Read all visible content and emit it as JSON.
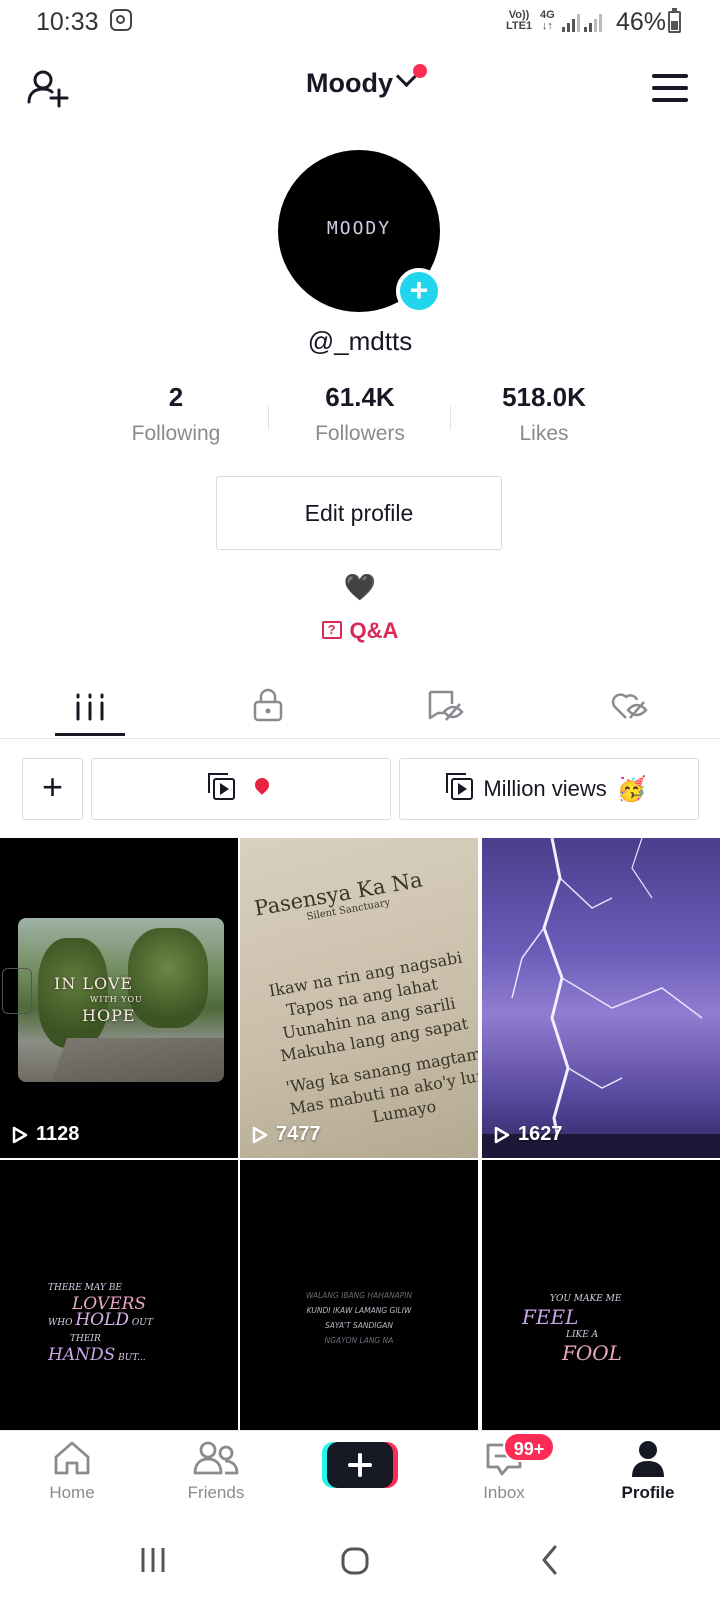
{
  "status_bar": {
    "time": "10:33",
    "volte": [
      "Vo))",
      "LTE1"
    ],
    "network": [
      "4G",
      "↓↑"
    ],
    "battery": "46%"
  },
  "header": {
    "title": "Moody",
    "notification_color": "#fe2c55"
  },
  "profile": {
    "avatar_text": "MOODY",
    "username": "@_mdtts",
    "stats": [
      {
        "value": "2",
        "label": "Following"
      },
      {
        "value": "61.4K",
        "label": "Followers"
      },
      {
        "value": "518.0K",
        "label": "Likes"
      }
    ],
    "edit_button": "Edit profile",
    "bio": "🖤",
    "qa_label": "Q&A",
    "qa_icon": "?"
  },
  "tabs": [
    {
      "icon": "grid-icon",
      "active": true
    },
    {
      "icon": "lock-icon",
      "active": false
    },
    {
      "icon": "eye-off-icon",
      "active": false
    },
    {
      "icon": "heart-off-icon",
      "active": false
    }
  ],
  "playlists": {
    "add": "+",
    "items": [
      {
        "label": "",
        "emoji": "pin"
      },
      {
        "label": "Million views",
        "emoji": "🥳"
      }
    ]
  },
  "videos": [
    {
      "views": "1128",
      "overlay": [
        "IN LOVE",
        "WITH YOU",
        "HOPE"
      ]
    },
    {
      "views": "7477",
      "overlay": [
        "Pasensya Ka Na",
        "Silent Sanctuary",
        "Ikaw na rin ang nagsabi",
        "Tapos na ang lahat",
        "Uunahin na ang sarili",
        "Makuha lang ang sapat",
        "'Wag ka sanang magtampo",
        "Mas mabuti na ako'y lumayo",
        "Lumayo"
      ]
    },
    {
      "views": "1627",
      "overlay": []
    },
    {
      "views": "",
      "overlay": [
        "THERE MAY BE",
        "LOVERS",
        "WHO",
        "HOLD",
        "OUT",
        "THEIR",
        "HANDS",
        "BUT..."
      ]
    },
    {
      "views": "",
      "overlay": [
        "WALANG IBANG HAHANAPIN",
        "KUNDI IKAW LAMANG GILIW",
        "SAYA'T SANDIGAN",
        "NGAYON LANG NA"
      ]
    },
    {
      "views": "",
      "overlay": [
        "YOU MAKE ME",
        "FEEL",
        "LIKE A",
        "FOOL"
      ]
    }
  ],
  "bottom_nav": [
    {
      "label": "Home",
      "icon": "home-icon",
      "active": false
    },
    {
      "label": "Friends",
      "icon": "friends-icon",
      "active": false
    },
    {
      "label": "",
      "icon": "create-icon",
      "active": false
    },
    {
      "label": "Inbox",
      "icon": "inbox-icon",
      "active": false,
      "badge": "99+"
    },
    {
      "label": "Profile",
      "icon": "profile-icon",
      "active": true
    }
  ]
}
